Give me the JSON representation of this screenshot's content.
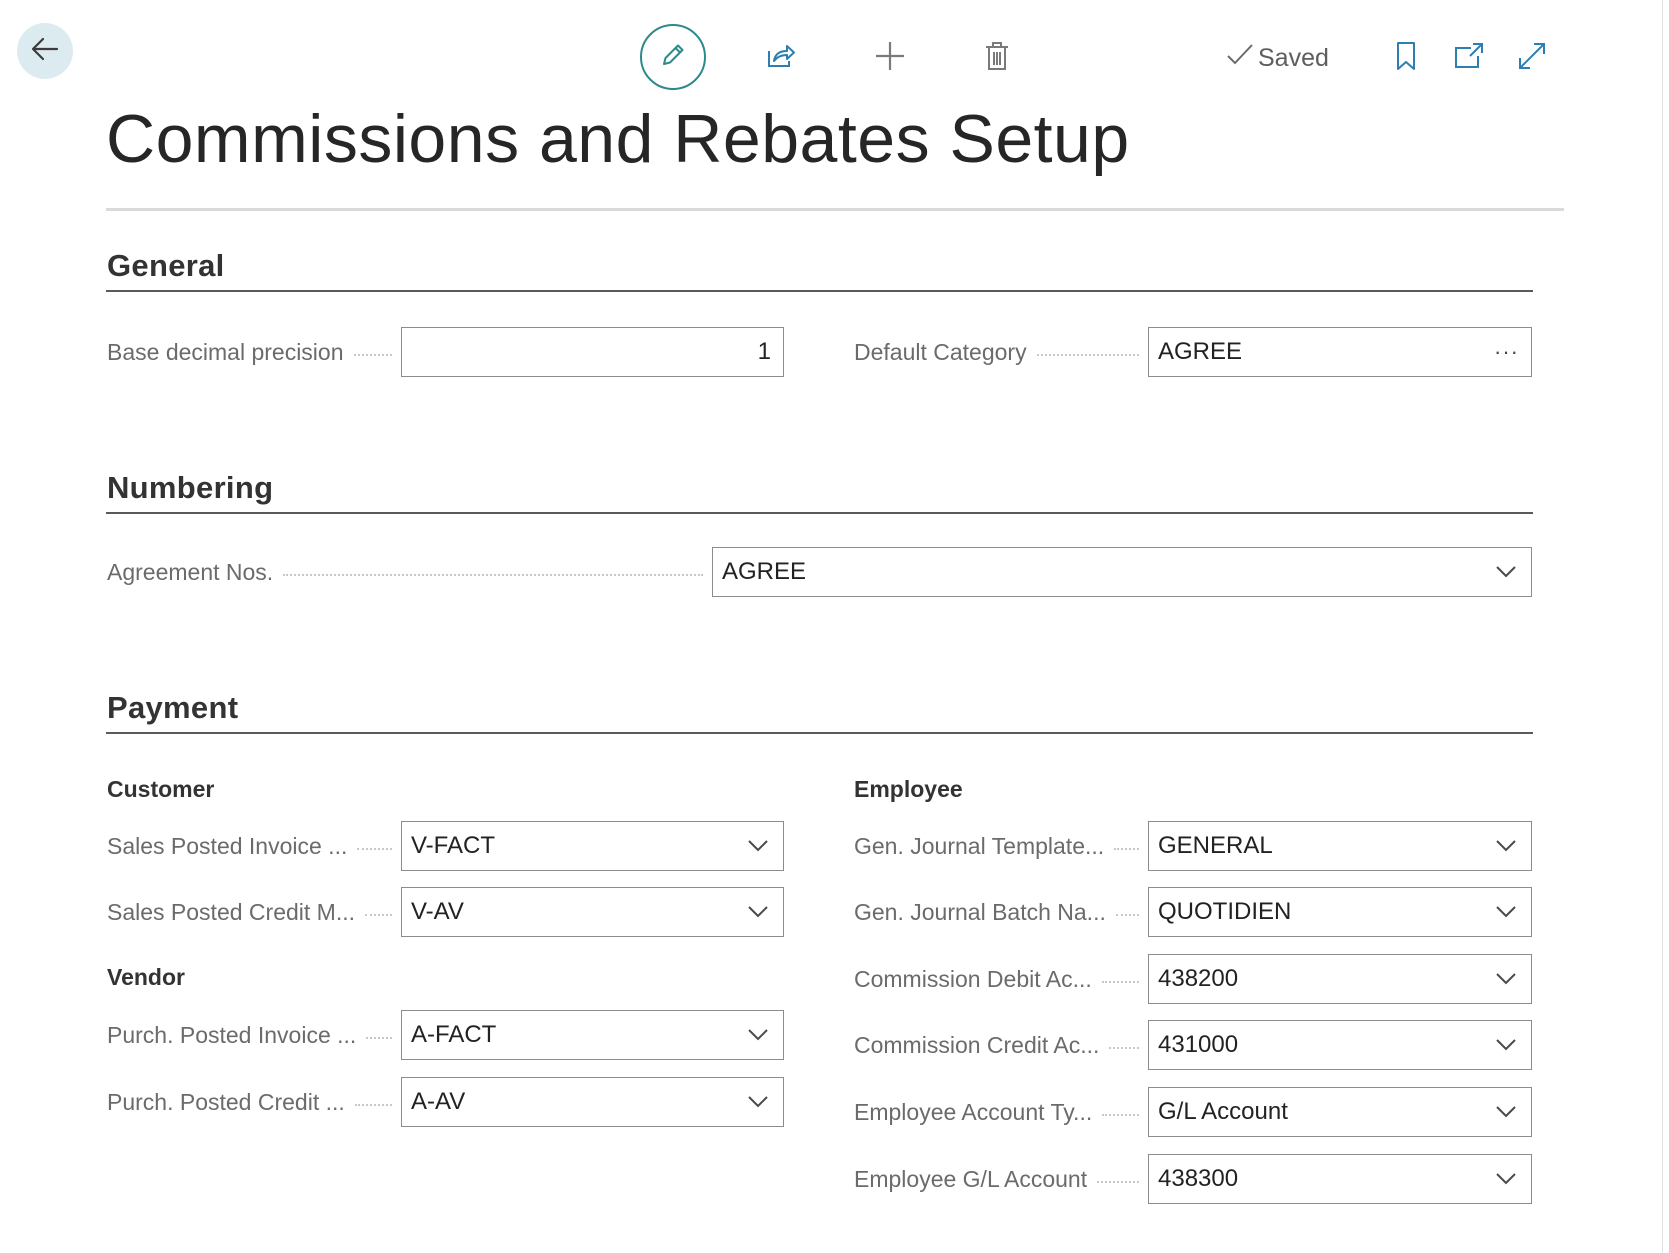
{
  "toolbar": {
    "back_icon": "arrow-left-icon",
    "edit_icon": "pencil-icon",
    "share_icon": "share-icon",
    "new_icon": "plus-icon",
    "delete_icon": "trash-icon",
    "saved_label": "Saved",
    "bookmark_icon": "bookmark-icon",
    "open_new_window_icon": "open-in-new-window-icon",
    "expand_icon": "expand-icon"
  },
  "page": {
    "title": "Commissions and Rebates Setup"
  },
  "sections": {
    "general": {
      "title": "General",
      "base_decimal_precision": {
        "label": "Base decimal precision",
        "value": "1"
      },
      "default_category": {
        "label": "Default Category",
        "value": "AGREE"
      }
    },
    "numbering": {
      "title": "Numbering",
      "agreement_nos": {
        "label": "Agreement Nos.",
        "value": "AGREE"
      }
    },
    "payment": {
      "title": "Payment",
      "customer": {
        "title": "Customer",
        "fields": [
          {
            "label": "Sales Posted Invoice ...",
            "value": "V-FACT"
          },
          {
            "label": "Sales Posted Credit M...",
            "value": "V-AV"
          }
        ]
      },
      "vendor": {
        "title": "Vendor",
        "fields": [
          {
            "label": "Purch. Posted Invoice ...",
            "value": "A-FACT"
          },
          {
            "label": "Purch. Posted Credit ...",
            "value": "A-AV"
          }
        ]
      },
      "employee": {
        "title": "Employee",
        "fields": [
          {
            "label": "Gen. Journal Template...",
            "value": "GENERAL"
          },
          {
            "label": "Gen. Journal Batch Na...",
            "value": "QUOTIDIEN"
          },
          {
            "label": "Commission Debit Ac...",
            "value": "438200"
          },
          {
            "label": "Commission Credit Ac...",
            "value": "431000"
          },
          {
            "label": "Employee Account Ty...",
            "value": "G/L Account"
          },
          {
            "label": "Employee G/L Account",
            "value": "438300"
          }
        ]
      }
    }
  },
  "colors": {
    "accent": "#2c8a8a",
    "back_button_bg": "#dcebef",
    "section_rule": "#5a5a5a",
    "field_border": "#8c8c8c",
    "label_text": "#6b6b6b"
  }
}
